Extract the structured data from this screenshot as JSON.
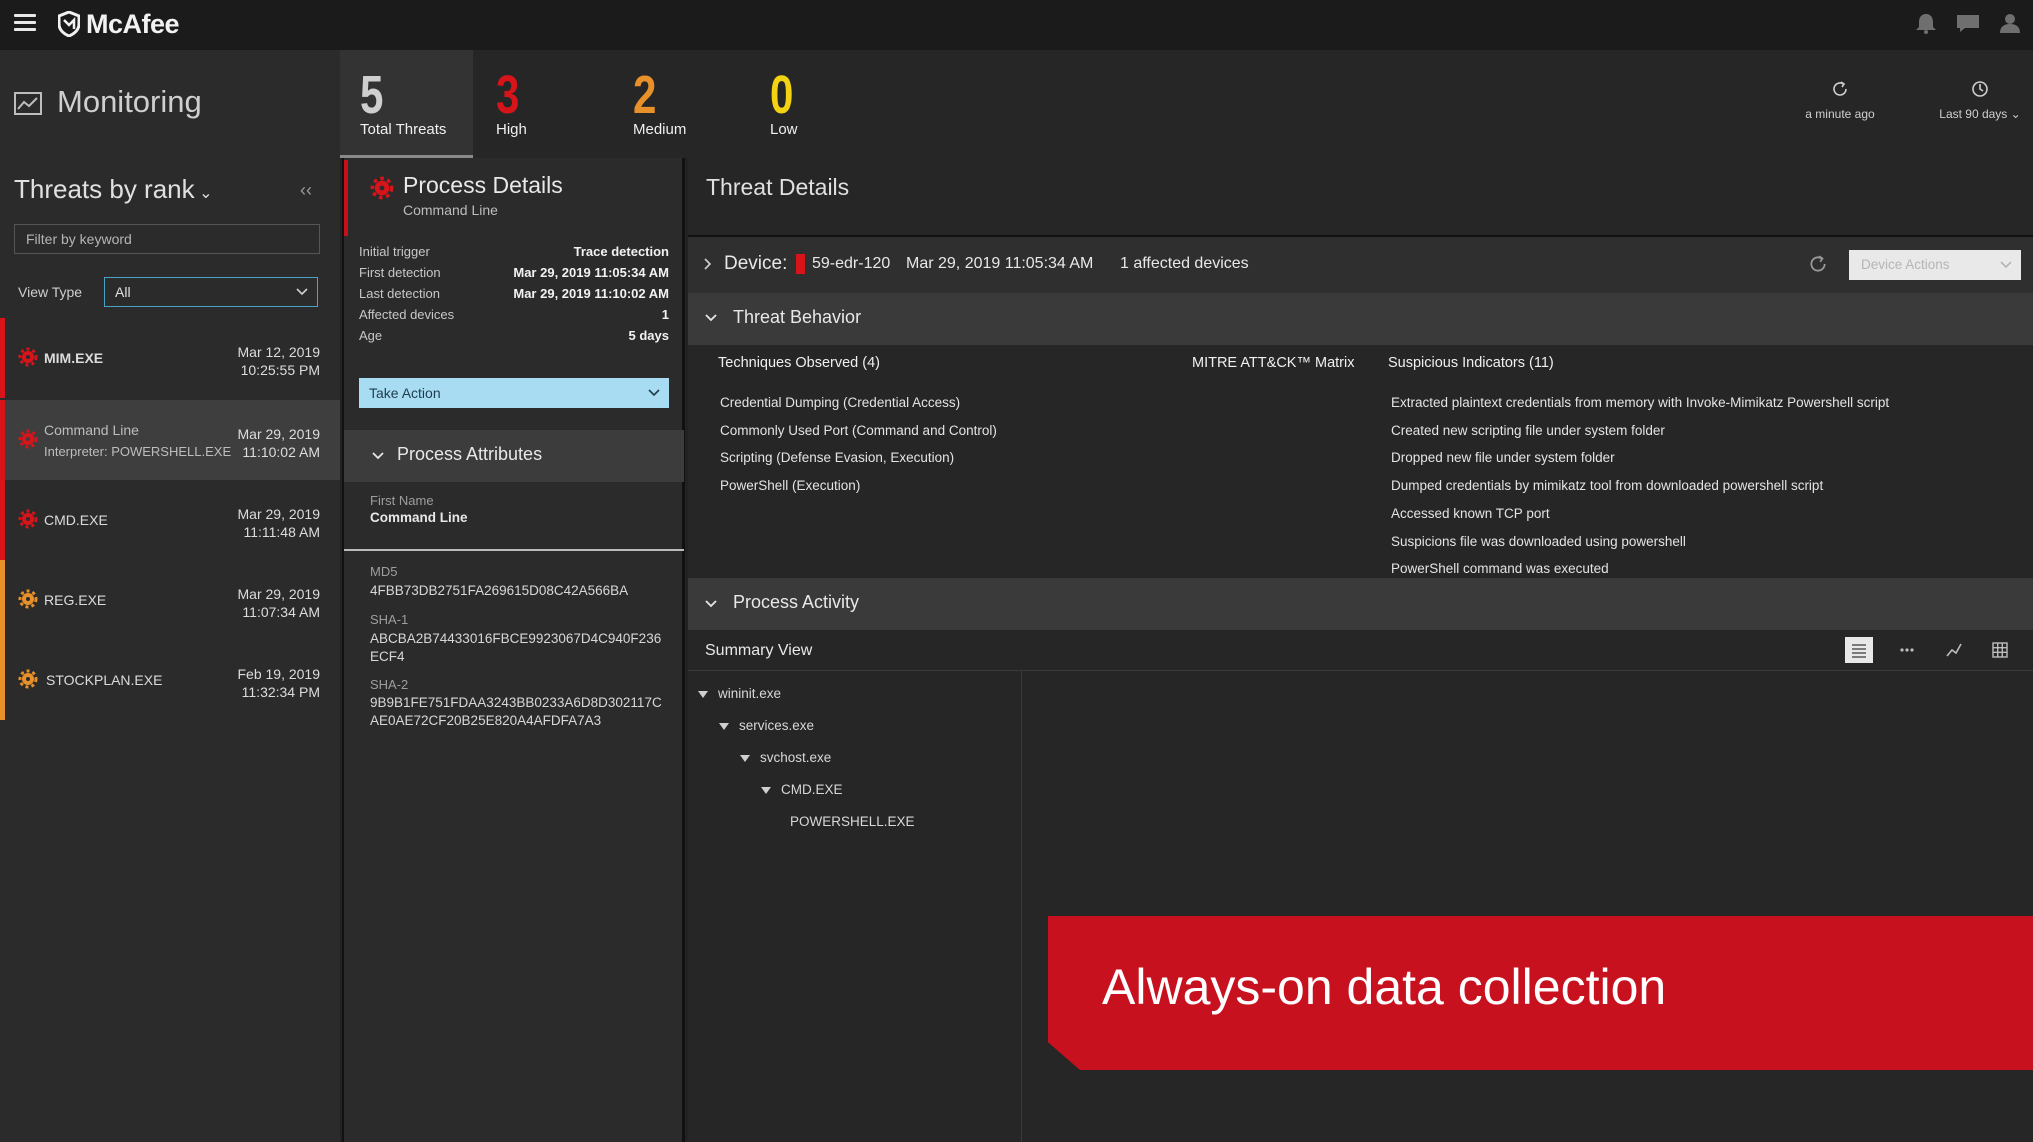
{
  "app": {
    "brand": "McAfee",
    "section_title": "Monitoring"
  },
  "colors": {
    "high": "#d7141a",
    "medium": "#e8902a",
    "low": "#f2d211",
    "accent": "#4aa3c6",
    "banner": "#c8111f"
  },
  "stats": [
    {
      "value": "5",
      "label": "Total Threats"
    },
    {
      "value": "3",
      "label": "High"
    },
    {
      "value": "2",
      "label": "Medium"
    },
    {
      "value": "0",
      "label": "Low"
    }
  ],
  "refresh": {
    "last_updated": "a minute ago",
    "range": "Last 90 days"
  },
  "left": {
    "title": "Threats by rank",
    "filter_placeholder": "Filter by keyword",
    "view_type_label": "View Type",
    "view_type_value": "All",
    "threats": [
      {
        "name": "MIM.EXE",
        "date": "Mar 12, 2019",
        "time": "10:25:55 PM",
        "severity": "high"
      },
      {
        "name": "Command Line",
        "sub": "Interpreter: POWERSHELL.EXE",
        "date": "Mar 29, 2019",
        "time": "11:10:02 AM",
        "severity": "high"
      },
      {
        "name": "CMD.EXE",
        "date": "Mar 29, 2019",
        "time": "11:11:48 AM",
        "severity": "high"
      },
      {
        "name": "REG.EXE",
        "date": "Mar 29, 2019",
        "time": "11:07:34 AM",
        "severity": "medium"
      },
      {
        "name": "STOCKPLAN.EXE",
        "date": "Feb 19, 2019",
        "time": "11:32:34 PM",
        "severity": "medium"
      }
    ]
  },
  "process_details": {
    "title": "Process Details",
    "subtitle": "Command Line",
    "fields": [
      {
        "key": "Initial trigger",
        "value": "Trace detection"
      },
      {
        "key": "First detection",
        "value": "Mar 29, 2019 11:05:34 AM"
      },
      {
        "key": "Last detection",
        "value": "Mar 29, 2019 11:10:02 AM"
      },
      {
        "key": "Affected devices",
        "value": "1"
      },
      {
        "key": "Age",
        "value": "5 days"
      }
    ],
    "take_action_label": "Take Action",
    "attributes_title": "Process Attributes",
    "first_name_label": "First Name",
    "first_name_value": "Command Line",
    "md5_label": "MD5",
    "md5_value": "4FBB73DB2751FA269615D08C42A566BA",
    "sha1_label": "SHA-1",
    "sha1_value": "ABCBA2B74433016FBCE9923067D4C940F236ECF4",
    "sha2_label": "SHA-2",
    "sha2_value": "9B9B1FE751FDAA3243BB0233A6D8D302117CAE0AE72CF20B25E820A4AFDFA7A3"
  },
  "threat_details": {
    "title": "Threat Details",
    "device_label": "Device:",
    "device_name": "59-edr-120",
    "device_date": "Mar 29, 2019 11:05:34 AM",
    "affected": "1 affected devices",
    "device_actions_label": "Device Actions",
    "behavior_title": "Threat Behavior",
    "techniques_header": "Techniques Observed (4)",
    "mitre_header": "MITRE ATT&CK™ Matrix",
    "indicators_header": "Suspicious Indicators (11)",
    "techniques": [
      "Credential Dumping (Credential Access)",
      "Commonly Used Port (Command and Control)",
      "Scripting (Defense Evasion, Execution)",
      "PowerShell (Execution)"
    ],
    "indicators": [
      "Extracted plaintext credentials from memory with Invoke-Mimikatz Powershell script",
      "Created new scripting file under system folder",
      "Dropped new file under system folder",
      "Dumped credentials by mimikatz tool from downloaded powershell script",
      "Accessed known TCP port",
      "Suspicions file was downloaded using powershell",
      "PowerShell command was executed"
    ],
    "activity_title": "Process Activity",
    "summary_view_label": "Summary View",
    "tree": [
      "wininit.exe",
      "services.exe",
      "svchost.exe",
      "CMD.EXE",
      "POWERSHELL.EXE"
    ]
  },
  "banner": {
    "text": "Always-on data collection"
  }
}
